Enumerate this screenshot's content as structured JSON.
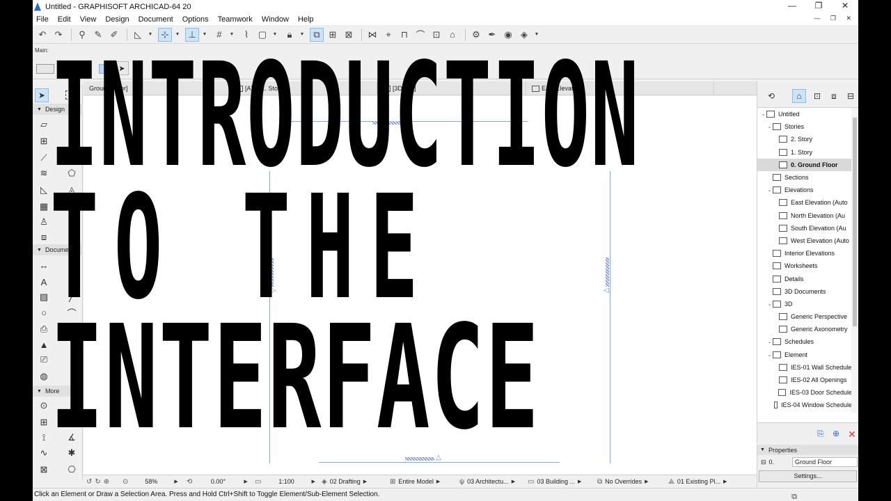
{
  "window": {
    "title": "Untitled - GRAPHISOFT ARCHICAD-64 20",
    "controls": [
      "—",
      "❐",
      "✕"
    ]
  },
  "menu": [
    "File",
    "Edit",
    "View",
    "Design",
    "Document",
    "Options",
    "Teamwork",
    "Window",
    "Help"
  ],
  "infobox": {
    "label": "Main:"
  },
  "toolbox": {
    "sections": [
      "Design",
      "Document",
      "More"
    ]
  },
  "tabs": [
    "Ground Floor]",
    "[A] 2. 1. Story]",
    "[3D / All]",
    "East Elevation"
  ],
  "statusbar": {
    "zoom": "58%",
    "angle": "0.00°",
    "scale": "1:100",
    "layer_combo": "02 Drafting",
    "model_view": "Entire Model",
    "pen_set": "03 Architectu...",
    "mvo": "03 Building ...",
    "graphic_override": "No Overrides",
    "renovation": "01 Existing Pl..."
  },
  "status_message": "Click an Element or Draw a Selection Area. Press and Hold Ctrl+Shift to Toggle Element/Sub-Element Selection.",
  "navigator": {
    "items": [
      {
        "label": "Untitled",
        "indent": 0,
        "expander": "⌄"
      },
      {
        "label": "Stories",
        "indent": 1,
        "expander": "⌄"
      },
      {
        "label": "2. Story",
        "indent": 2,
        "expander": ""
      },
      {
        "label": "1. Story",
        "indent": 2,
        "expander": ""
      },
      {
        "label": "0. Ground Floor",
        "indent": 2,
        "expander": "",
        "selected": true
      },
      {
        "label": "Sections",
        "indent": 1,
        "expander": ""
      },
      {
        "label": "Elevations",
        "indent": 1,
        "expander": "⌄"
      },
      {
        "label": "East Elevation (Auto",
        "indent": 2,
        "expander": ""
      },
      {
        "label": "North Elevation (Au",
        "indent": 2,
        "expander": ""
      },
      {
        "label": "South Elevation (Au",
        "indent": 2,
        "expander": ""
      },
      {
        "label": "West Elevation (Auto",
        "indent": 2,
        "expander": ""
      },
      {
        "label": "Interior Elevations",
        "indent": 1,
        "expander": ""
      },
      {
        "label": "Worksheets",
        "indent": 1,
        "expander": ""
      },
      {
        "label": "Details",
        "indent": 1,
        "expander": ""
      },
      {
        "label": "3D Documents",
        "indent": 1,
        "expander": ""
      },
      {
        "label": "3D",
        "indent": 1,
        "expander": "⌄"
      },
      {
        "label": "Generic Perspective",
        "indent": 2,
        "expander": ""
      },
      {
        "label": "Generic Axonometry",
        "indent": 2,
        "expander": ""
      },
      {
        "label": "Schedules",
        "indent": 1,
        "expander": "⌄"
      },
      {
        "label": "Element",
        "indent": 1,
        "expander": "⌄"
      },
      {
        "label": "IES-01 Wall Schedule",
        "indent": 2,
        "expander": ""
      },
      {
        "label": "IES-02 All Openings",
        "indent": 2,
        "expander": ""
      },
      {
        "label": "IES-03 Door Schedule",
        "indent": 2,
        "expander": ""
      },
      {
        "label": "IES-04 Window Schedule",
        "indent": 2,
        "expander": ""
      }
    ]
  },
  "properties": {
    "header": "Properties",
    "id": "0.",
    "name": "Ground Floor",
    "settings": "Settings..."
  },
  "overlay": {
    "line1": "INTRODUCTION",
    "line2": "TO THE",
    "line3": "INTERFACE"
  }
}
